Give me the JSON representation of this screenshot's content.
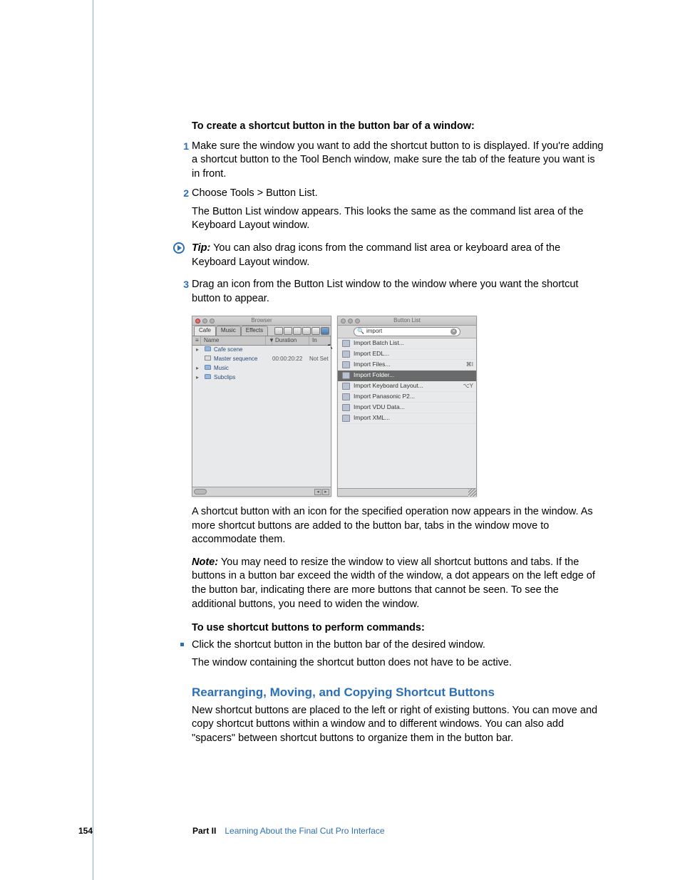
{
  "headings": {
    "create_shortcut": "To create a shortcut button in the button bar of a window:",
    "use_shortcut": "To use shortcut buttons to perform commands:",
    "rearranging": "Rearranging, Moving, and Copying Shortcut Buttons"
  },
  "steps": {
    "s1": "Make sure the window you want to add the shortcut button to is displayed. If you're adding a shortcut button to the Tool Bench window, make sure the tab of the feature you want is in front.",
    "s2": "Choose Tools > Button List.",
    "s2b": "The Button List window appears. This looks the same as the command list area of the Keyboard Layout window.",
    "tip_label": "Tip:",
    "tip_text": "  You can also drag icons from the command list area or keyboard area of the Keyboard Layout window.",
    "s3": "Drag an icon from the Button List window to the window where you want the shortcut button to appear."
  },
  "after_figure_para": "A shortcut button with an icon for the specified operation now appears in the window. As more shortcut buttons are added to the button bar, tabs in the window move to accommodate them.",
  "note_label": "Note:",
  "note_text": "  You may need to resize the window to view all shortcut buttons and tabs. If the buttons in a button bar exceed the width of the window, a dot appears on the left edge of the button bar, indicating there are more buttons that cannot be seen. To see the additional buttons, you need to widen the window.",
  "bullet": "Click the shortcut button in the button bar of the desired window.",
  "bullet_sub": "The window containing the shortcut button does not have to be active.",
  "rearranging_para": "New shortcut buttons are placed to the left or right of existing buttons. You can move and copy shortcut buttons within a window and to different windows. You can also add \"spacers\" between shortcut buttons to organize them in the button bar.",
  "figure": {
    "browser_title": "Browser",
    "buttonlist_title": "Button List",
    "tabs": {
      "cafe": "Cafe",
      "music": "Music",
      "effects": "Effects"
    },
    "columns": {
      "name": "Name",
      "duration": "Duration",
      "in": "In"
    },
    "rows": {
      "r1": {
        "name": "Cafe scene"
      },
      "r2": {
        "name": "Master sequence",
        "dur": "00:00:20:22",
        "in": "Not Set"
      },
      "r3": {
        "name": "Music"
      },
      "r4": {
        "name": "Subclips"
      }
    },
    "search_text": "import",
    "list_items": [
      {
        "label": "Import Batch List...",
        "sc": ""
      },
      {
        "label": "Import EDL...",
        "sc": ""
      },
      {
        "label": "Import Files...",
        "sc": "⌘I"
      },
      {
        "label": "Import Folder...",
        "sc": "",
        "sel": true
      },
      {
        "label": "Import Keyboard Layout...",
        "sc": "⌥Y"
      },
      {
        "label": "Import Panasonic P2...",
        "sc": ""
      },
      {
        "label": "Import VDU Data...",
        "sc": ""
      },
      {
        "label": "Import XML...",
        "sc": ""
      }
    ]
  },
  "footer": {
    "page": "154",
    "part": "Part II",
    "chapter": "Learning About the Final Cut Pro Interface"
  }
}
